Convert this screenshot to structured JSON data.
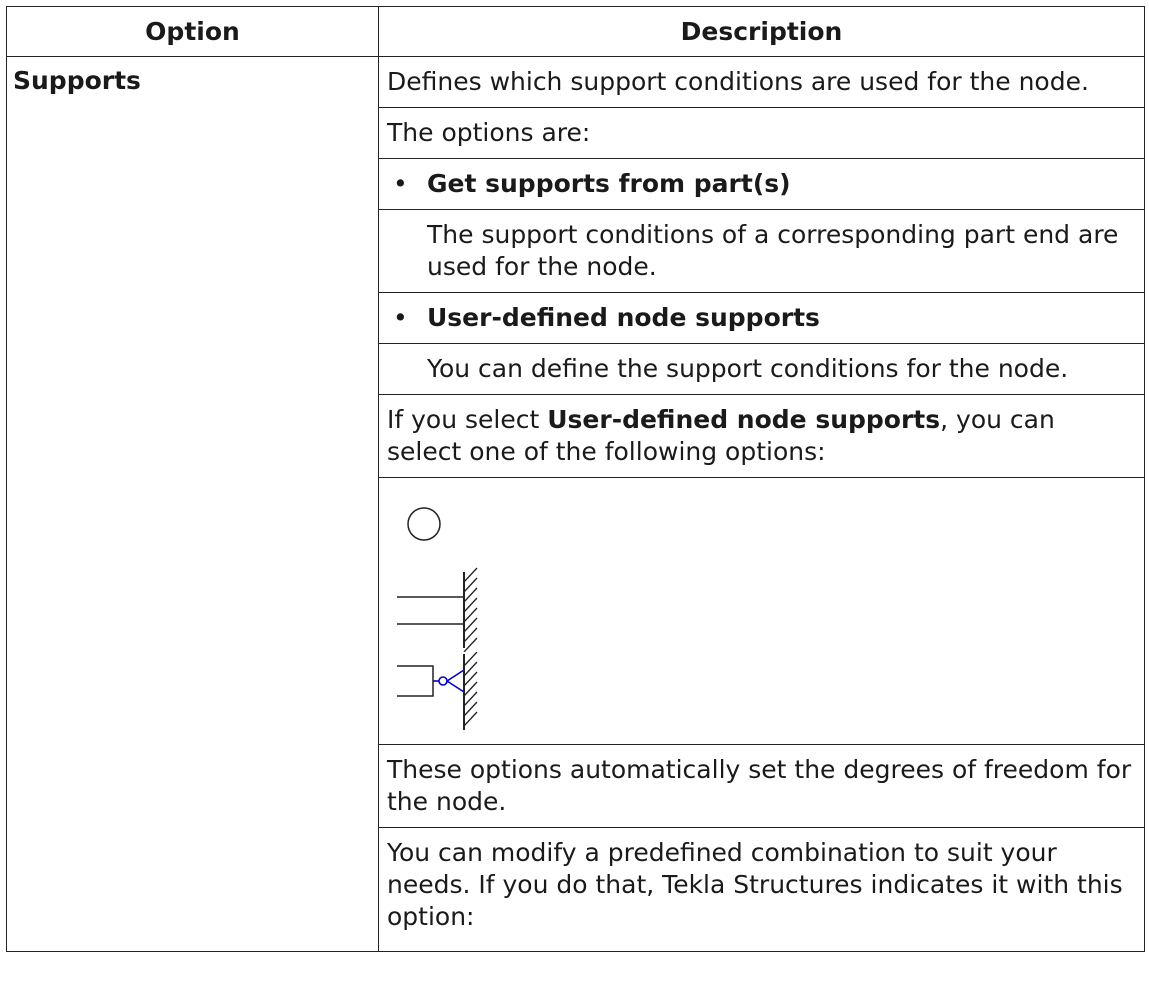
{
  "table": {
    "header_option": "Option",
    "header_description": "Description"
  },
  "row": {
    "option": "Supports",
    "intro": "Defines which support conditions are used for the node.",
    "options_are": "The options are:",
    "bullets": [
      {
        "title": "Get supports from part(s)",
        "text": "The support conditions of a corresponding part end are used for the node."
      },
      {
        "title": "User-defined node supports",
        "text": "You can define the support conditions for the node."
      }
    ],
    "select_prefix": "If you select ",
    "select_bold": "User-defined node supports",
    "select_suffix": ", you can select one of the following options:",
    "support_icons": [
      "circle-support-icon",
      "fixed-support-icon",
      "spring-support-icon"
    ],
    "automatic_text": "These options automatically set the degrees of freedom for the node.",
    "modify_text": "You can modify a predefined combination to suit your needs. If you do that, Tekla Structures indicates it with this option:"
  },
  "colors": {
    "border": "#222222",
    "spring": "#0000cc"
  }
}
